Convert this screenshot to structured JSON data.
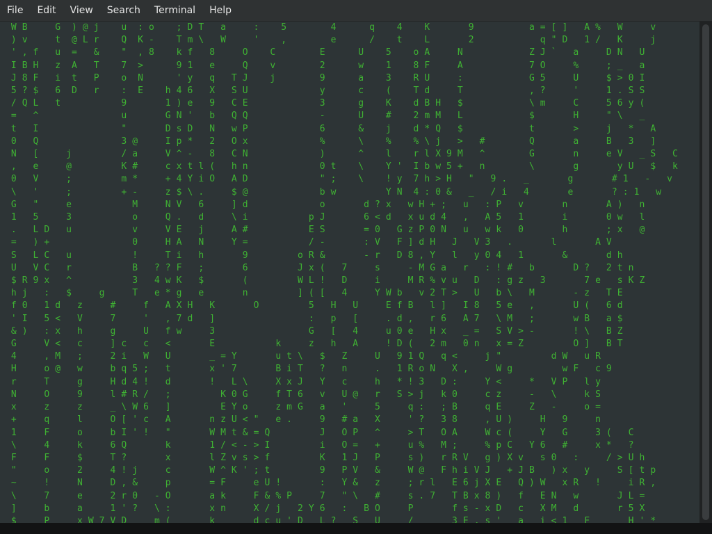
{
  "menu": {
    "file": "File",
    "edit": "Edit",
    "view": "View",
    "search": "Search",
    "terminal": "Terminal",
    "help": "Help"
  },
  "terminal": {
    "content": "  W B     G  ) @ j    u  : o    ; D T   a     :    5        4      q    4    K       9          a = [ ]   A %   W     v\n  ) v     t  @ L r    Q  K -    T m \\   W     '    ,        e      /    t    L       2            q \" D   1 /   K     j\n  ' , f   u  =   &    \"  , 8    k f   8     O    C        E      U    5    o A     N            Z J `   a     D N   U\n  I B H   z  A   T    7  >      9 1   e     Q    v        2      w    1    8 F     A            7 O     %     ; _   a\n  J 8 F   i  t   P    o  N      ' y   q   T J    j        9      a    3    R U     :            G 5     U     $ > 0 I\n  5 ? $   6  D   r    :  E    h 4 6   X   S U             y      c    (    T d     T            , ?     '     1 . S S\n  / Q L   t           9       1 ) e   9   C E             3      g    K    d B H   $            \\ m     C     5 6 y (\n  =   ^               u       G N '   b   Q Q             -      U    #    2 m M   L            $       H     \" \\   _\n  t   I               \"       D s D   N   w P             6      &    j    d * Q   $            t       >     j   *   A\n  0   Q               3 @     I p *   2   O x             %      \\    %    % \\ j   >   #        Q       a     B   3   ]\n  N   [     j         / a     V ^ -   8   C N             )      ^    l    r l X 9 M   ^        G       n     e V   _ S   C\n  ,   e     @         K #     c x t l (   h n             0 t    \\    Y '  I b w 5 +   n        \\       g       y U   $   k\n  0   V     ;         m *     + 4 Y i O   A D             \" ;    \\    ! y  7 h > H   \"   9 .   _       g       # 1   -   v\n  \\   '     ;         + -     z $ \\ .     $ @             b w         Y N  4 : 0 &   _   / i   4       e       ? : 1   w\n  G   \"     e           M     N V   6     ] d             o       d ? x   w H + ;   u   : P   v       n       A )   n\n  1   5     3           o     Q .   d     \\ i           p J       6 < d   x u d 4   ,   A 5   1       i       0 w   l\n  .   L D   u           v     V E   j     A #           E S       = 0   G z P 0 N   u   w k   0       h       ; x   @\n  =   ) +               0     H A   N     Y =           / -       : V   F ] d H   J   V 3   .       l       A V\n  S   L C   u           !     T i   h       9         o R &       - r   D 8 , Y   l   y 0 4   1       &       d h\n  U   V C   r           B   ? ? F   ;       6         J x (   7     s     - M G a   r   : ! #   b       D ?   2 t n\n  $ R 9 x   ^           3   4 w K   $       (         W L !   D     i     M R % v u   D   : g z   3       7 e   s K Z\n  h j   :   $     g     T   e * g   e       n         ] ( [   4     Y W b   v 2 T >   U   b \\   M       - z   T E\n  f 0   1 d   z     #     f   A X H   K       O         5   H   U     E f B   l ]   I 8   5 e   ,       U (   6 d\n  ' I   5 <   V     7     '   , 7 d   ]                 :   p   [     . d ,   r 6   A 7   \\ M   ;       w B   a $\n  & )   : x   h     g     U   f w     3                 G   [   4     u 0 e   H x   _ =   S V > -       ! \\   B Z\n  G     V <   c     ] c   c   <       E           k     z   h   A     ! D (   2 m   0 n   x = Z         O ]   B T\n  4     , M   ;     2 i   W   U       _ = Y       u t \\   $   Z     U   9 1 Q   q <     j \"         d W   u R\n  H     o @   w     b q 5 ;   t       x ' 7       B i T   ?   n     .   1 R o N   X ,     W g         w F   c 9\n  r     T     g     H d 4 !   d       !   L \\     X x J   Y   c     h   * ! 3   D :     Y <     *   V P   l y\n  N     O     9     l # R /   ;         K 0 G     f T 6   v   U @   r   S > j   k 0     c z     -   \\     k S\n  x     z     z     _ \\ W 6   ]         E Y o     z m G   a   '     5     q :   ; B     q E     Z   -     o =\n  +     q     l     O [ ' c   A       n z U < \"   e .     9   # a   X     ' ?   3 8     , U )     H   9     n\n  1     F     o     b I ' !   \"       W M t & = Q         J   O P   ^     > T   O A     W c (     Y   G     3 (   C\n  \\     4     k     6 Q       k       1 / < - > I         i   O =   +     u %   M ;     % p C   Y 6   #     x *   ?\n  F     F     $     T ?       x       l Z v s > f         K   1 J   P     s )   r R V   g ) X v   s 0   :     / > U h\n  \"     o     2     4 ! j     c       W ^ K ' ; t         9   P V   &     W @   F h i V J   + J B   ) x   y     S [ t p\n  ~     !     N     D , &     p       = F     e U !       :   Y &   z     ; r l   E 6 j X E   Q ) W   x R   !     i R ,\n  \\     7     e     2 r 0   - O       a k     F & % P     7   \" \\   #     s . 7   T B x 8 )   f   E N   w       J L =\n  ]     b     a     1 ' ?   \\ :       x n     X / j   2 Y 6   :   B O     P       f s - x D   c   X M   d       r 5 X\n  $     P     x W 7 V D     m (       k       d c u ' D   L ?   S   U     /       3 E , s '   a   i < 1   F     _ H ' *"
  }
}
